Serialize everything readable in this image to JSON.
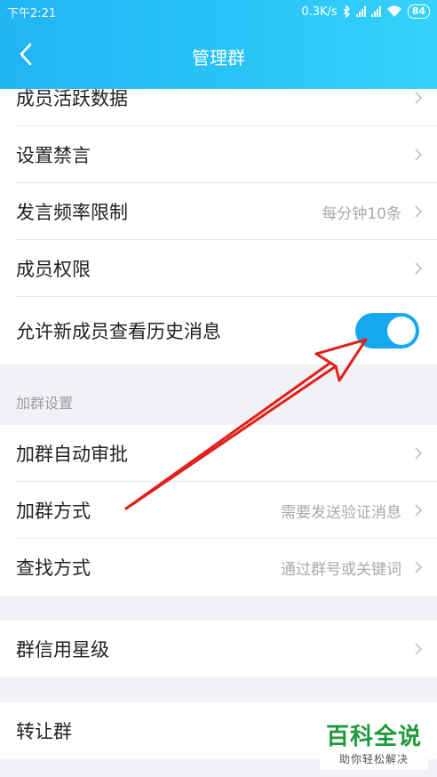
{
  "status": {
    "time": "下午2:21",
    "speed": "0.3K/s",
    "battery": "84"
  },
  "nav": {
    "title": "管理群"
  },
  "rows_group1": [
    {
      "label": "成员活跃数据",
      "value": ""
    },
    {
      "label": "设置禁言",
      "value": ""
    },
    {
      "label": "发言频率限制",
      "value": "每分钟10条"
    },
    {
      "label": "成员权限",
      "value": ""
    }
  ],
  "history_toggle": {
    "label": "允许新成员查看历史消息",
    "enabled": true
  },
  "join_section": {
    "title": "加群设置",
    "rows": [
      {
        "label": "加群自动审批",
        "value": ""
      },
      {
        "label": "加群方式",
        "value": "需要发送验证消息"
      },
      {
        "label": "查找方式",
        "value": "通过群号或关键词"
      }
    ]
  },
  "credit_row": {
    "label": "群信用星级"
  },
  "transfer_row": {
    "label": "转让群"
  },
  "watermark": {
    "title": "百科全说",
    "subtitle": "助你轻松解决"
  },
  "colors": {
    "header_start": "#22b4f3",
    "header_end": "#36d2fb",
    "toggle_on": "#15a8f1",
    "arrow": "#e0201c",
    "watermark": "#1e9a3c"
  }
}
